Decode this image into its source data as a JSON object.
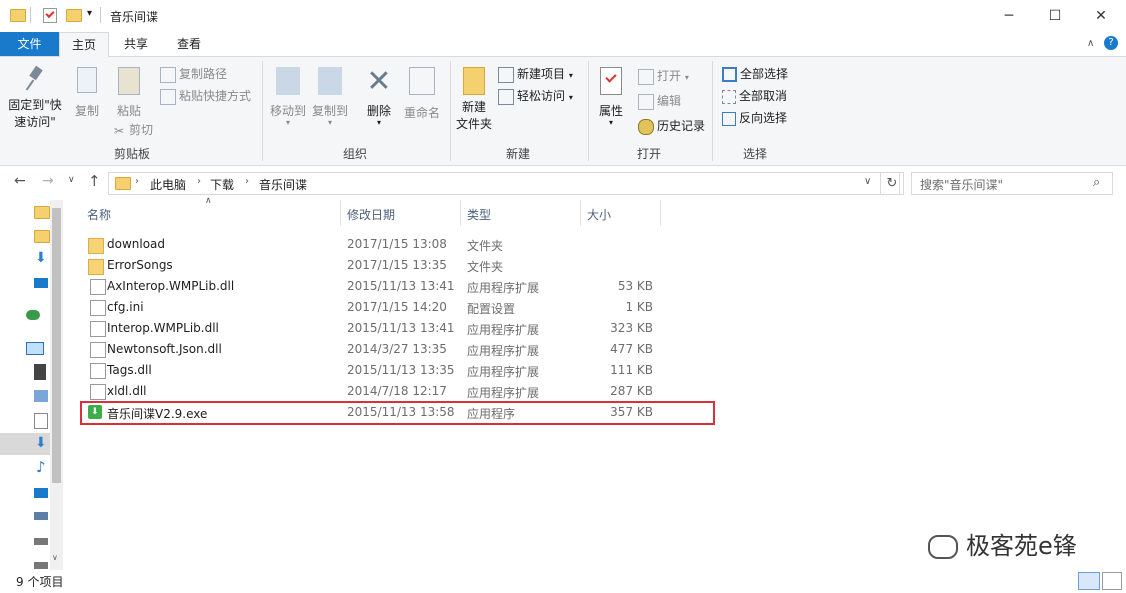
{
  "title": "音乐间谍",
  "ribbon_tabs": [
    "文件",
    "主页",
    "共享",
    "查看"
  ],
  "ribbon": {
    "pin_quick_access": "固定到\"快速访问\"",
    "copy": "复制",
    "paste": "粘贴",
    "copy_path": "复制路径",
    "paste_shortcut": "粘贴快捷方式",
    "cut": "剪切",
    "clipboard_group": "剪贴板",
    "move_to": "移动到",
    "copy_to": "复制到",
    "delete": "删除",
    "rename": "重命名",
    "organize_group": "组织",
    "new_folder": "新建\n文件夹",
    "new_item": "新建项目",
    "easy_access": "轻松访问",
    "new_group": "新建",
    "properties": "属性",
    "open": "打开",
    "edit": "编辑",
    "history": "历史记录",
    "open_group": "打开",
    "select_all": "全部选择",
    "select_none": "全部取消",
    "invert_selection": "反向选择",
    "select_group": "选择"
  },
  "address": {
    "crumbs": [
      "此电脑",
      "下载",
      "音乐间谍"
    ],
    "search_placeholder": "搜索\"音乐间谍\""
  },
  "columns": {
    "name": "名称",
    "date": "修改日期",
    "type": "类型",
    "size": "大小"
  },
  "files": [
    {
      "name": "download",
      "date": "2017/1/15 13:08",
      "type": "文件夹",
      "size": "",
      "kind": "folder"
    },
    {
      "name": "ErrorSongs",
      "date": "2017/1/15 13:35",
      "type": "文件夹",
      "size": "",
      "kind": "folder"
    },
    {
      "name": "AxInterop.WMPLib.dll",
      "date": "2015/11/13 13:41",
      "type": "应用程序扩展",
      "size": "53 KB",
      "kind": "dll"
    },
    {
      "name": "cfg.ini",
      "date": "2017/1/15 14:20",
      "type": "配置设置",
      "size": "1 KB",
      "kind": "ini"
    },
    {
      "name": "Interop.WMPLib.dll",
      "date": "2015/11/13 13:41",
      "type": "应用程序扩展",
      "size": "323 KB",
      "kind": "dll"
    },
    {
      "name": "Newtonsoft.Json.dll",
      "date": "2014/3/27 13:35",
      "type": "应用程序扩展",
      "size": "477 KB",
      "kind": "dll"
    },
    {
      "name": "Tags.dll",
      "date": "2015/11/13 13:35",
      "type": "应用程序扩展",
      "size": "111 KB",
      "kind": "dll"
    },
    {
      "name": "xldl.dll",
      "date": "2014/7/18 12:17",
      "type": "应用程序扩展",
      "size": "287 KB",
      "kind": "dll"
    },
    {
      "name": "音乐间谍V2.9.exe",
      "date": "2015/11/13 13:58",
      "type": "应用程序",
      "size": "357 KB",
      "kind": "exe"
    }
  ],
  "status": "9 个项目",
  "watermark": "极客苑e锋"
}
